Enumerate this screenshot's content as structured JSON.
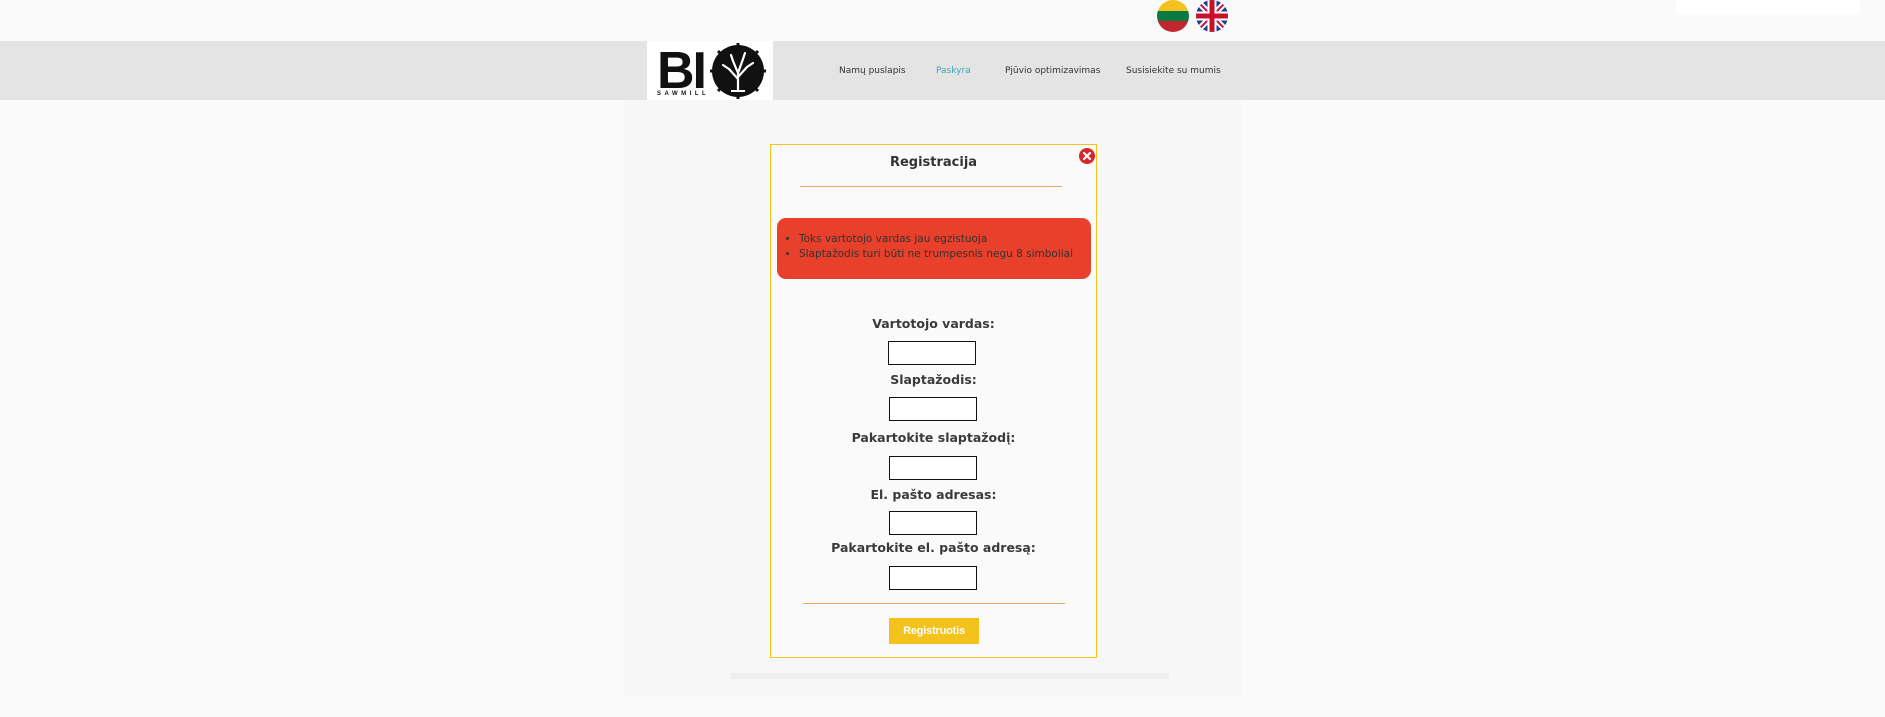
{
  "top": {
    "search_value": "",
    "flags": [
      {
        "name": "lithuanian-flag-icon",
        "lang": "LT"
      },
      {
        "name": "uk-flag-icon",
        "lang": "EN"
      }
    ]
  },
  "logo": {
    "text": "BI",
    "subtitle": "SAWMILL"
  },
  "nav": {
    "items": [
      {
        "label": "Namų puslapis",
        "active": false
      },
      {
        "label": "Paskyra",
        "active": true
      },
      {
        "label": "Pjūvio optimizavimas",
        "active": false
      },
      {
        "label": "Susisiekite su mumis",
        "active": false
      }
    ]
  },
  "modal": {
    "title": "Registracija",
    "errors": [
      "Toks vartotojo vardas jau egzistuoja",
      "Slaptažodis turi būti ne trumpesnis negu 8 simboliai"
    ],
    "fields": {
      "username_label": "Vartotojo vardas:",
      "password_label": "Slaptažodis:",
      "password_repeat_label": "Pakartokite slaptažodį:",
      "email_label": "El. pašto adresas:",
      "email_repeat_label": "Pakartokite el. pašto adresą:"
    },
    "values": {
      "username": "",
      "password": "",
      "password_repeat": "",
      "email": "",
      "email_repeat": ""
    },
    "submit_label": "Registruotis"
  },
  "colors": {
    "accent_yellow": "#f4c21c",
    "error_red": "#e8402a",
    "nav_active": "#3aa6b9",
    "close_red": "#d9262b"
  }
}
